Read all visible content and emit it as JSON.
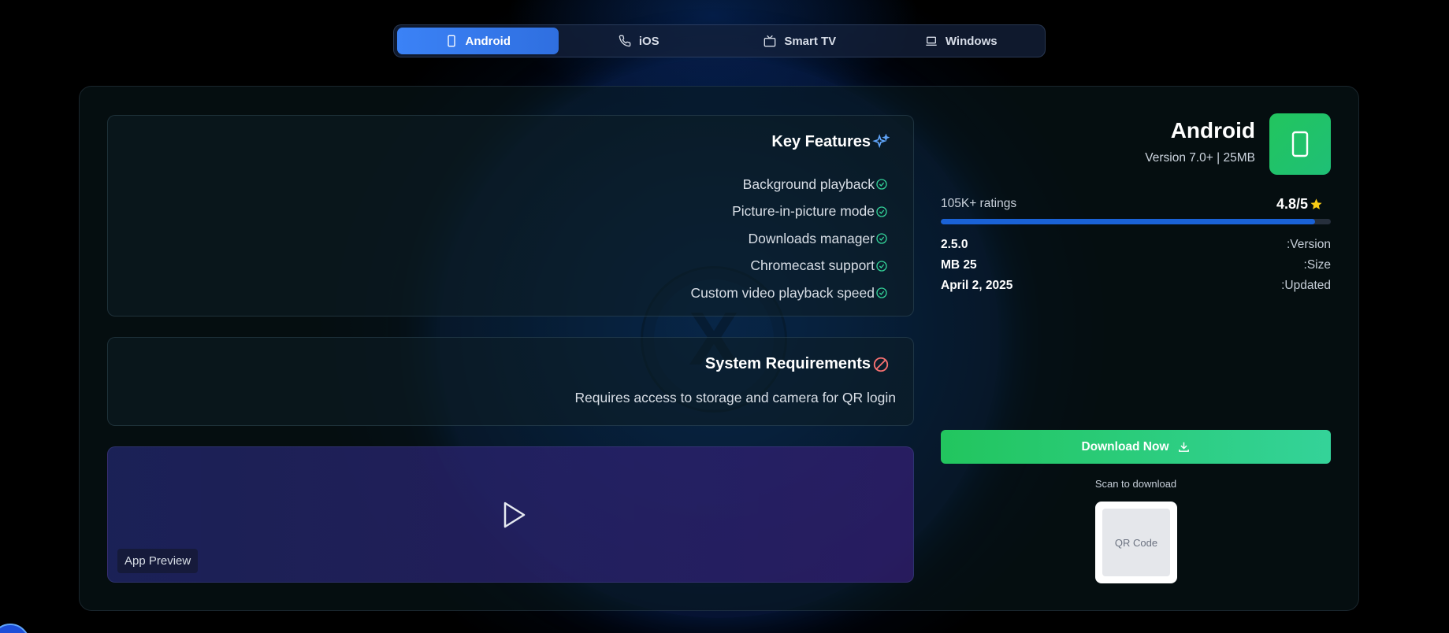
{
  "tabs": [
    {
      "label": "Android",
      "icon": "tablet-icon",
      "active": true
    },
    {
      "label": "iOS",
      "icon": "phone-icon",
      "active": false
    },
    {
      "label": "Smart TV",
      "icon": "tv-icon",
      "active": false
    },
    {
      "label": "Windows",
      "icon": "laptop-icon",
      "active": false
    }
  ],
  "features": {
    "title": "Key Features",
    "icon": "sparkles-icon",
    "items": [
      "Background playback",
      "Picture-in-picture mode",
      "Downloads manager",
      "Chromecast support",
      "Custom video playback speed"
    ]
  },
  "requirements": {
    "title": "System Requirements",
    "icon": "no-symbol-icon",
    "text": "Requires access to storage and camera for QR login"
  },
  "preview": {
    "badge": "App Preview",
    "icon": "play-icon"
  },
  "app": {
    "name": "Android",
    "meta": "Version 7.0+ | 25MB",
    "icon": "tablet-icon",
    "ratings_label": "105K+ ratings",
    "rating": "4.8/5",
    "rating_fraction": 0.96,
    "details": [
      {
        "value": "2.5.0",
        "label": ":Version"
      },
      {
        "value": "MB 25",
        "label": ":Size"
      },
      {
        "value": "April 2, 2025",
        "label": ":Updated"
      }
    ],
    "download_label": "Download Now",
    "scan_label": "Scan to download",
    "qr_placeholder": "QR Code"
  },
  "colors": {
    "accent_blue": "#3b82f6",
    "accent_green": "#22c55e",
    "star": "#facc15",
    "check": "#34d399",
    "warning": "#f87171"
  }
}
